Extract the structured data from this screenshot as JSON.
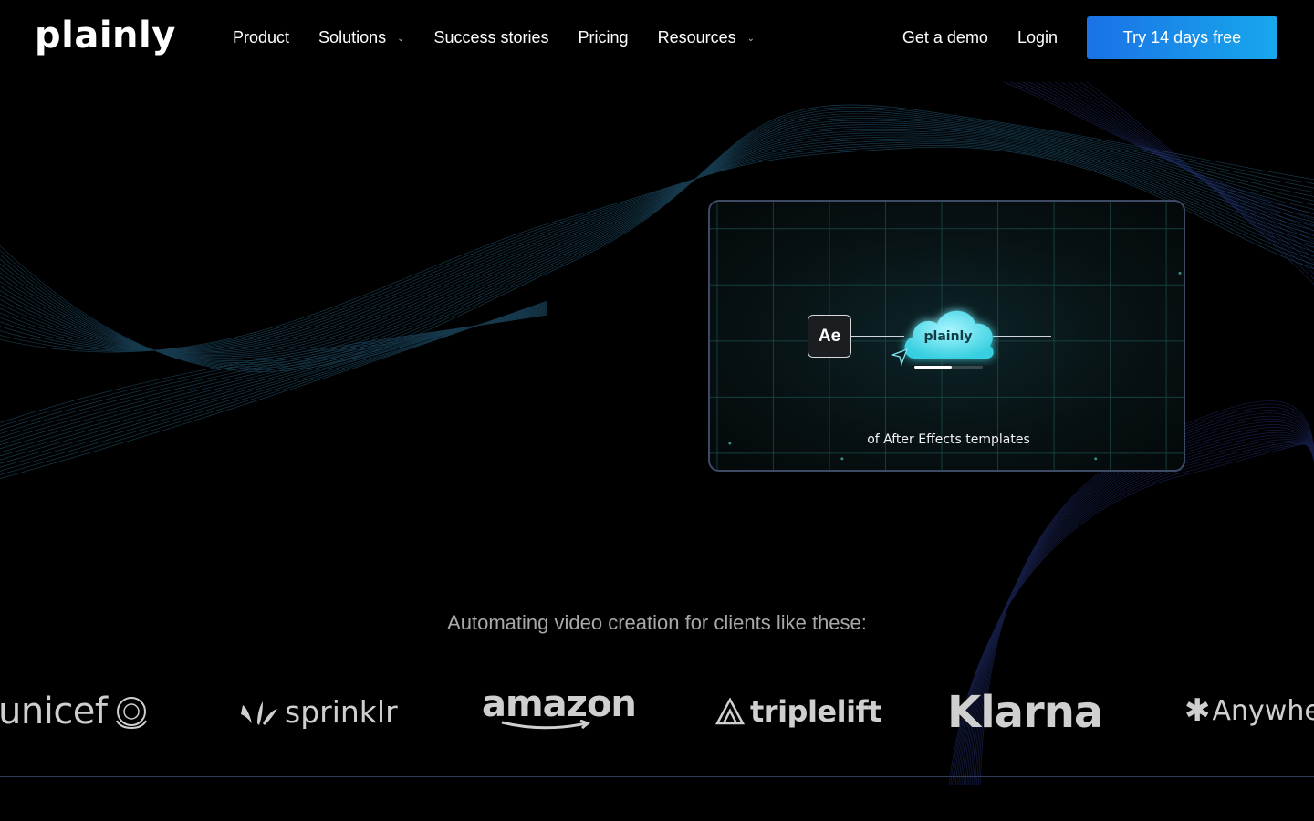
{
  "brand": {
    "name": "plainly"
  },
  "nav": {
    "items": [
      {
        "label": "Product",
        "has_dropdown": false
      },
      {
        "label": "Solutions",
        "has_dropdown": true
      },
      {
        "label": "Success stories",
        "has_dropdown": false
      },
      {
        "label": "Pricing",
        "has_dropdown": false
      },
      {
        "label": "Resources",
        "has_dropdown": true
      }
    ],
    "demo_label": "Get a demo",
    "login_label": "Login",
    "cta_label": "Try 14 days free"
  },
  "hero": {
    "ae_label": "Ae",
    "cloud_label": "plainly",
    "caption": "of After Effects templates",
    "progress_fraction": 0.55
  },
  "clients": {
    "tagline": "Automating video creation for clients like these:",
    "logos": [
      "unicef",
      "sprinklr",
      "amazon",
      "triplelift",
      "Klarna",
      "Anywhere"
    ]
  },
  "colors": {
    "background": "#000000",
    "cta_start": "#1a72e6",
    "cta_end": "#18a8ec",
    "cloud": "#5fe3f0",
    "card_border": "#3d4a63"
  }
}
